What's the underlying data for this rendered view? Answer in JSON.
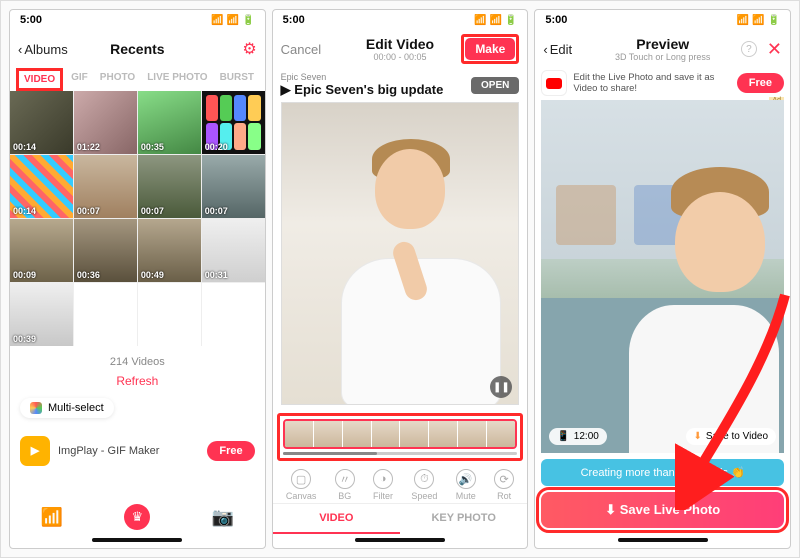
{
  "status_time": "5:00",
  "screen1": {
    "back": "Albums",
    "title": "Recents",
    "tabs": [
      "VIDEO",
      "GIF",
      "PHOTO",
      "LIVE PHOTO",
      "BURST"
    ],
    "durations": [
      "00:14",
      "01:22",
      "00:35",
      "00:20",
      "00:14",
      "00:07",
      "00:07",
      "00:07",
      "00:09",
      "00:36",
      "00:49",
      "00:31",
      "00:39"
    ],
    "count": "214 Videos",
    "refresh": "Refresh",
    "multiselect": "Multi-select",
    "ad_app": "ImgPlay - GIF Maker",
    "ad_cta": "Free"
  },
  "screen2": {
    "cancel": "Cancel",
    "title": "Edit Video",
    "subtitle": "00:00 - 00:05",
    "make": "Make",
    "ad_small": "Epic Seven",
    "ad_big": "Epic Seven's big update",
    "ad_open": "OPEN",
    "tools": [
      "Canvas",
      "BG",
      "Filter",
      "Speed",
      "Mute",
      "Rot"
    ],
    "subtabs": [
      "VIDEO",
      "KEY PHOTO"
    ]
  },
  "screen3": {
    "back": "Edit",
    "title": "Preview",
    "subtitle": "3D Touch or Long press",
    "ad_text": "Edit the Live Photo and save it as Video to share!",
    "ad_cta": "Free",
    "clock": "12:00",
    "save_to_video": "Save to Video",
    "banner": "Creating more than 5 seconds 👏",
    "save": "Save Live Photo"
  }
}
